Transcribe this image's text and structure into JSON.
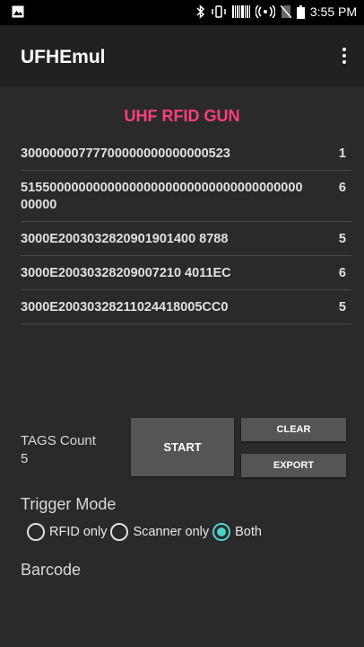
{
  "status_bar": {
    "time": "3:55 PM",
    "icons": [
      "image-icon",
      "bluetooth-icon",
      "vibrate-icon",
      "barcode-icon",
      "hotspot-icon",
      "no-sim-icon",
      "battery-icon"
    ]
  },
  "app_bar": {
    "title": "UFHEmul",
    "menu_icon": "overflow-menu-icon"
  },
  "heading": "UHF RFID GUN",
  "colors": {
    "accent": "#ff3e7f",
    "radio_checked": "#4dd0c8",
    "background": "#2a2a2a",
    "app_bar": "#212121"
  },
  "tags": [
    {
      "epc": "30000000777700000000000000523",
      "count": "1"
    },
    {
      "epc": "51550000000000000000000000000000000000000000",
      "count": "6"
    },
    {
      "epc": "3000E2003032820901901400 8788",
      "count": "5"
    },
    {
      "epc": "3000E20030328209007210 4011EC",
      "count": "6"
    },
    {
      "epc": "3000E20030328211024418005CC0",
      "count": "5"
    }
  ],
  "counter": {
    "label": "TAGS Count",
    "value": "5"
  },
  "buttons": {
    "start": "START",
    "clear": "CLEAR",
    "export": "EXPORT"
  },
  "trigger": {
    "label": "Trigger Mode",
    "options": [
      "RFID only",
      "Scanner only",
      "Both"
    ],
    "selected": "Both"
  },
  "barcode": {
    "label": "Barcode",
    "value": ""
  }
}
